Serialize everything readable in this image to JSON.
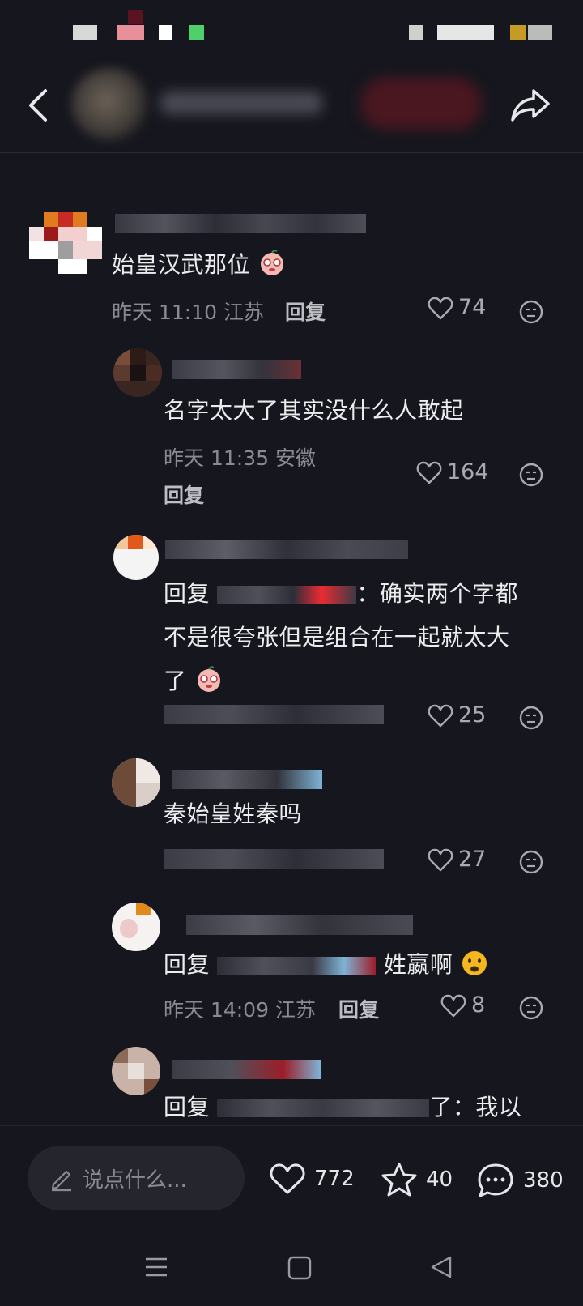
{
  "comments": [
    {
      "text": "始皇汉武那位",
      "time": "昨天 11:10 江苏",
      "reply": "回复",
      "likes": "74"
    },
    {
      "text": "名字太大了其实没什么人敢起",
      "time": "昨天 11:35 安徽",
      "reply": "回复",
      "likes": "164"
    },
    {
      "prefix": "回复",
      "text1": "：确实两个字都",
      "text2": "不是很夸张但是组合在一起就太大",
      "text3": "了",
      "likes": "25"
    },
    {
      "text": "秦始皇姓秦吗",
      "likes": "27"
    },
    {
      "prefix": "回复",
      "text": "姓嬴啊",
      "time": "昨天 14:09 江苏",
      "reply": "回复",
      "likes": "8"
    },
    {
      "prefix": "回复",
      "text_end": "了：我以"
    }
  ],
  "bottom": {
    "input_placeholder": "说点什么...",
    "likes": "772",
    "favorites": "40",
    "comments": "380"
  },
  "colors": {
    "background": "#16161e",
    "text": "#ececef",
    "meta": "#8a8a92"
  }
}
